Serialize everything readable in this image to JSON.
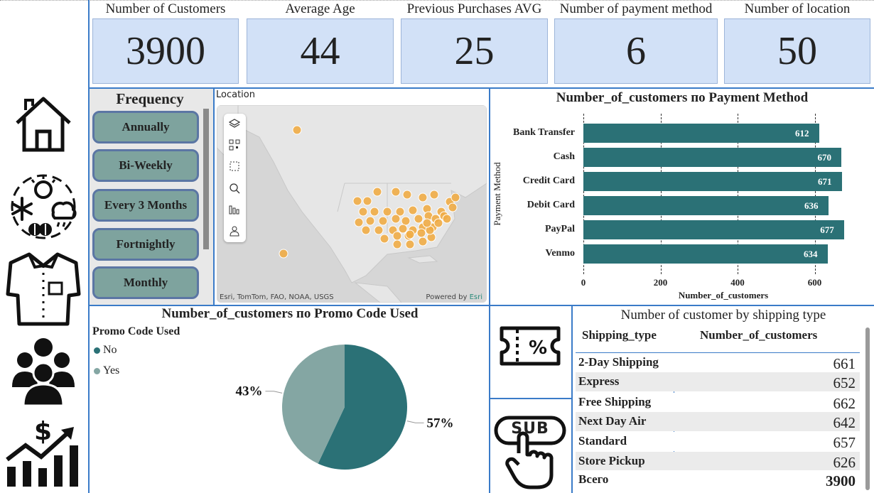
{
  "nav": {
    "items": [
      {
        "name": "home-icon"
      },
      {
        "name": "weather-icon"
      },
      {
        "name": "shirt-icon"
      },
      {
        "name": "people-icon"
      },
      {
        "name": "sales-growth-icon"
      }
    ]
  },
  "kpis": [
    {
      "title": "Number of Customers",
      "value": "3900"
    },
    {
      "title": "Average Age",
      "value": "44"
    },
    {
      "title": "Previous Purchases AVG",
      "value": "25"
    },
    {
      "title": "Number of payment method",
      "value": "6"
    },
    {
      "title": "Number of location",
      "value": "50"
    }
  ],
  "slicer": {
    "title": "Frequency",
    "items": [
      "Annually",
      "Bi-Weekly",
      "Every 3 Months",
      "Fortnightly",
      "Monthly"
    ]
  },
  "map": {
    "title": "Location",
    "attribution": "Esri, TomTom, FAO, NOAA, USGS",
    "powered_by": "Powered by",
    "powered_by_link": "Esri",
    "tools": [
      "layers-icon",
      "qr-icon",
      "select-icon",
      "search-icon",
      "bars-icon",
      "person-icon"
    ],
    "dot_color": "#f0ac46"
  },
  "chart_data": [
    {
      "type": "bar",
      "orientation": "horizontal",
      "title": "Number_of_customers по Payment Method",
      "xlabel": "Number_of_customers",
      "ylabel": "Payment Method",
      "categories": [
        "Bank Transfer",
        "Cash",
        "Credit Card",
        "Debit Card",
        "PayPal",
        "Venmo"
      ],
      "values": [
        612,
        670,
        671,
        636,
        677,
        634
      ],
      "value_labels": [
        "612",
        "670",
        "671",
        "636",
        "677",
        "634"
      ],
      "xticks": [
        "0",
        "200",
        "400",
        "600"
      ],
      "xlim": [
        0,
        690
      ],
      "grid": "vertical dashed",
      "color": "#2b7176"
    },
    {
      "type": "pie",
      "title": "Number_of_customers по Promo Code Used",
      "legend_title": "Promo Code Used",
      "legend_placement": "top-left",
      "categories": [
        "No",
        "Yes"
      ],
      "values": [
        57,
        43
      ],
      "value_labels": [
        "57%",
        "43%"
      ],
      "colors": [
        "#2b7176",
        "#84a6a3"
      ]
    }
  ],
  "table": {
    "title": "Number of customer by shipping type",
    "headers": [
      "Shipping_type",
      "Number_of_customers"
    ],
    "rows": [
      [
        "2-Day Shipping",
        "661"
      ],
      [
        "Express",
        "652"
      ],
      [
        "Free Shipping",
        "662"
      ],
      [
        "Next Day Air",
        "642"
      ],
      [
        "Standard",
        "657"
      ],
      [
        "Store Pickup",
        "626"
      ]
    ],
    "total_label": "Всего",
    "total_value": "3900"
  },
  "buttons": {
    "discount": "discount-ticket-icon",
    "subscribe": "SUB"
  }
}
